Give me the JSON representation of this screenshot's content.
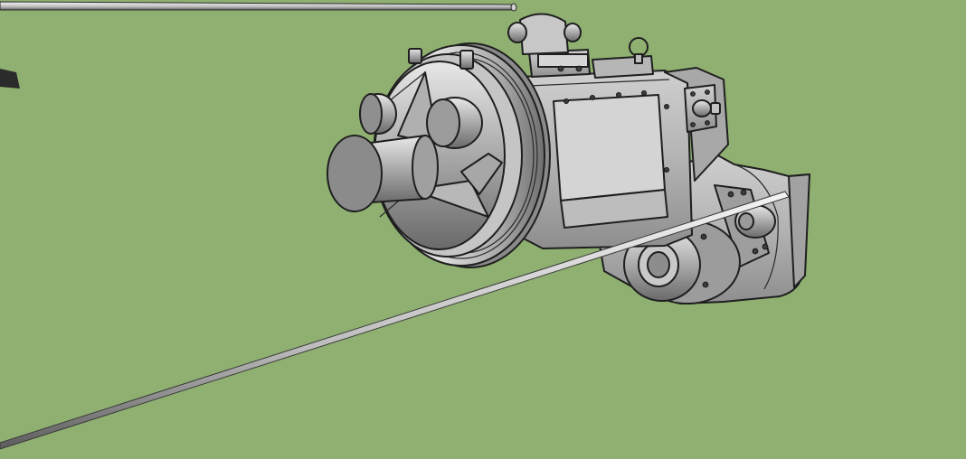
{
  "viewport": {
    "background_color": "#8fb071",
    "render_style": "shaded-with-edges"
  },
  "model": {
    "name": "winch-assembly",
    "face_color": "#b9b9b9",
    "edge_color": "#1f1f1f"
  },
  "cable": {
    "color": "#d8d8d8"
  },
  "axis_line": {
    "color": "#2b2b2b"
  }
}
